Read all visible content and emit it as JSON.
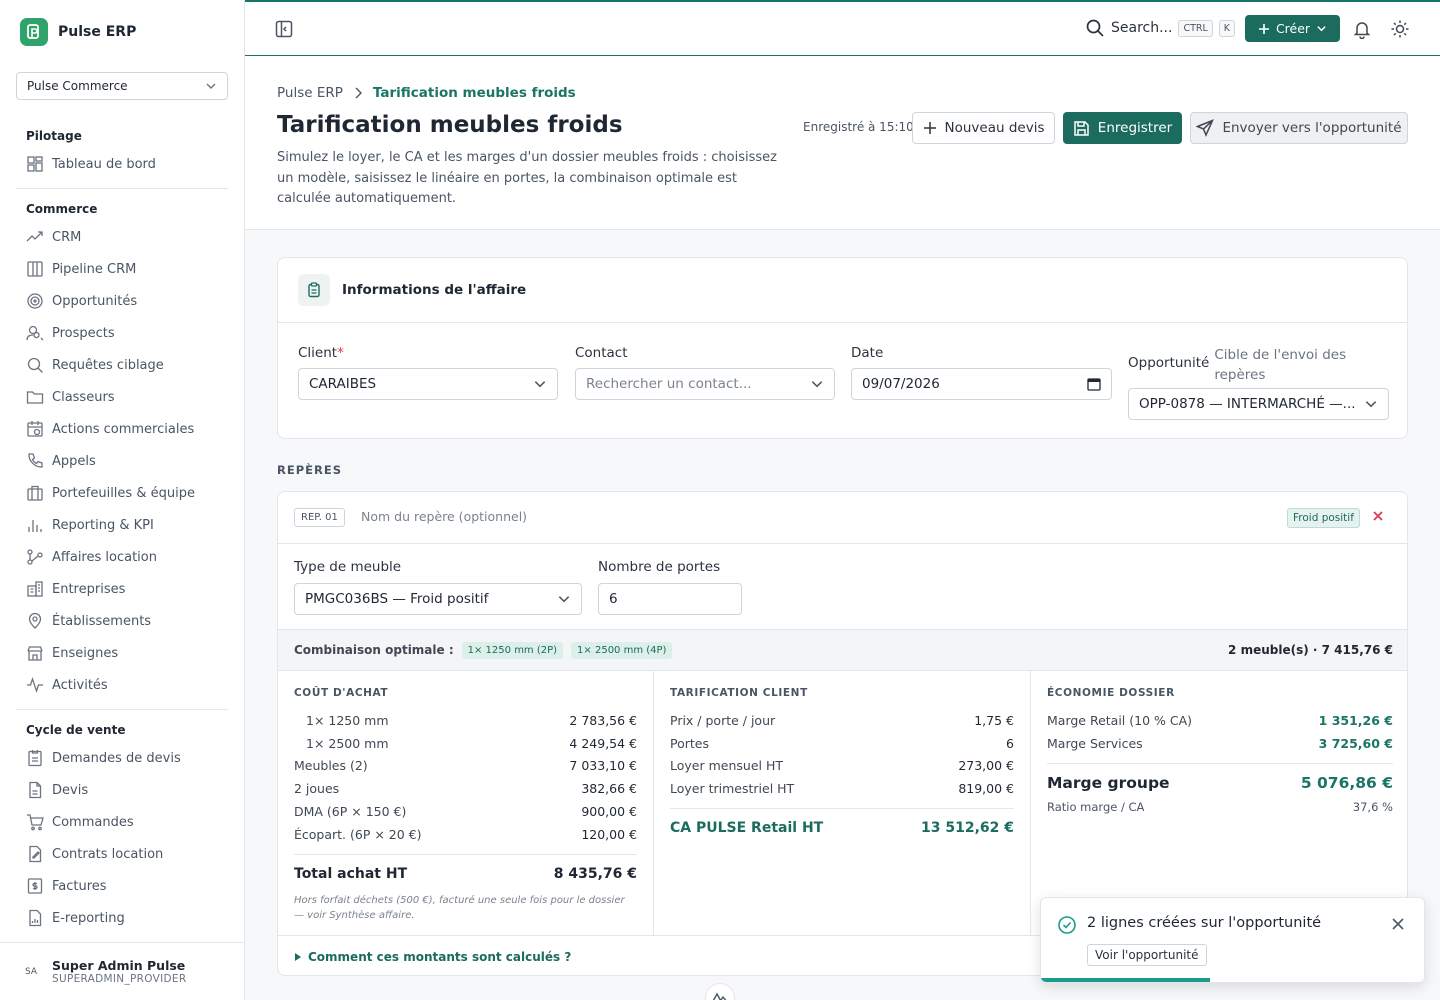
{
  "app": {
    "name": "Pulse ERP",
    "company": "Pulse Commerce"
  },
  "sidebar": {
    "sections": [
      {
        "title": "Pilotage",
        "items": [
          "Tableau de bord"
        ]
      },
      {
        "title": "Commerce",
        "items": [
          "CRM",
          "Pipeline CRM",
          "Opportunités",
          "Prospects",
          "Requêtes ciblage",
          "Classeurs",
          "Actions commerciales",
          "Appels",
          "Portefeuilles & équipe",
          "Reporting & KPI",
          "Affaires location",
          "Entreprises",
          "Établissements",
          "Enseignes",
          "Activités"
        ]
      },
      {
        "title": "Cycle de vente",
        "items": [
          "Demandes de devis",
          "Devis",
          "Commandes",
          "Contrats location",
          "Factures",
          "E-reporting"
        ]
      }
    ],
    "user": {
      "initials": "SA",
      "name": "Super Admin Pulse",
      "role": "SUPERADMIN_PROVIDER"
    }
  },
  "topbar": {
    "search": "Search...",
    "kbd1": "CTRL",
    "kbd2": "K",
    "create": "Créer"
  },
  "header": {
    "crumb_root": "Pulse ERP",
    "crumb_current": "Tarification meubles froids",
    "title": "Tarification meubles froids",
    "description": "Simulez le loyer, le CA et les marges d'un dossier meubles froids : choisissez un modèle, saisissez le linéaire en portes, la combinaison optimale est calculée automatiquement.",
    "saved": "Enregistré à 15:10",
    "btn_new": "Nouveau devis",
    "btn_save": "Enregistrer",
    "btn_send": "Envoyer vers l'opportunité"
  },
  "info": {
    "title": "Informations de l'affaire",
    "client_label": "Client",
    "client_req": "*",
    "client_value": "CARAIBES",
    "contact_label": "Contact",
    "contact_placeholder": "Rechercher un contact...",
    "date_label": "Date",
    "date_value": "09/07/2026",
    "opp_label": "Opportunité",
    "opp_sub": "Cible de l'envoi des repères",
    "opp_value": "OPP-0878 — INTERMARCHÉ —..."
  },
  "reperes": {
    "title": "REPÈRES",
    "no": "REP. 01",
    "name_placeholder": "Nom du repère (optionnel)",
    "badge": "Froid positif",
    "type_label": "Type de meuble",
    "type_value": "PMGC036BS — Froid positif",
    "portes_label": "Nombre de portes",
    "portes_value": "6",
    "combo_label": "Combinaison optimale :",
    "combo_chips": [
      "1× 1250 mm (2P)",
      "1× 2500 mm (4P)"
    ],
    "combo_total": "2 meuble(s) · 7 415,76 €",
    "achat": {
      "title": "COÛT D'ACHAT",
      "rows": [
        {
          "l": "1× 1250 mm",
          "v": "2 783,56 €",
          "ind": true
        },
        {
          "l": "1× 2500 mm",
          "v": "4 249,54 €",
          "ind": true
        },
        {
          "l": "Meubles (2)",
          "v": "7 033,10 €"
        },
        {
          "l": "2 joues",
          "v": "382,66 €"
        },
        {
          "l": "DMA (6P × 150 €)",
          "v": "900,00 €"
        },
        {
          "l": "Écopart. (6P × 20 €)",
          "v": "120,00 €"
        }
      ],
      "total_l": "Total achat HT",
      "total_v": "8 435,76 €",
      "note": "Hors forfait déchets (500 €), facturé une seule fois pour le dossier — voir Synthèse affaire."
    },
    "client": {
      "title": "TARIFICATION CLIENT",
      "rows": [
        {
          "l": "Prix / porte / jour",
          "v": "1,75 €"
        },
        {
          "l": "Portes",
          "v": "6"
        },
        {
          "l": "Loyer mensuel HT",
          "v": "273,00 €"
        },
        {
          "l": "Loyer trimestriel HT",
          "v": "819,00 €"
        }
      ],
      "ca_l": "CA PULSE Retail HT",
      "ca_v": "13 512,62 €"
    },
    "eco": {
      "title": "ÉCONOMIE DOSSIER",
      "rows": [
        {
          "l": "Marge Retail (10 % CA)",
          "v": "1 351,26 €"
        },
        {
          "l": "Marge Services",
          "v": "3 725,60 €"
        }
      ],
      "mg_l": "Marge groupe",
      "mg_v": "5 076,86 €",
      "ratio_l": "Ratio marge / CA",
      "ratio_v": "37,6 %"
    },
    "footer": "Comment ces montants sont calculés ?"
  },
  "toast": {
    "text": "2 lignes créées sur l'opportunité",
    "action": "Voir l'opportunité",
    "progress": 0.44
  },
  "colors": {
    "accent": "#1b6b5f",
    "brand": "#2fa36b",
    "danger": "#d9394a"
  }
}
